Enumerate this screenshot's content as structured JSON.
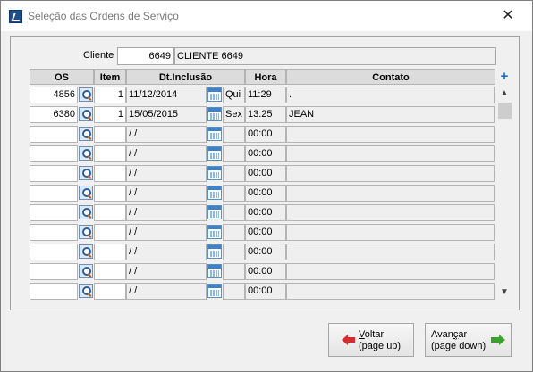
{
  "window": {
    "title": "Seleção das Ordens de Serviço",
    "close_label": "✕"
  },
  "cliente": {
    "label": "Cliente",
    "code": "6649",
    "name": "CLIENTE 6649"
  },
  "table": {
    "columns": {
      "os": "OS",
      "item": "Item",
      "dt": "Dt.Inclusão",
      "hora": "Hora",
      "contato": "Contato"
    },
    "add_label": "+",
    "rows": [
      {
        "os": "4856",
        "item": "1",
        "dt": "11/12/2014",
        "dia": "Qui",
        "hora": "11:29",
        "contato": "."
      },
      {
        "os": "6380",
        "item": "1",
        "dt": "15/05/2015",
        "dia": "Sex",
        "hora": "13:25",
        "contato": "JEAN"
      },
      {
        "os": "",
        "item": "",
        "dt": " / /",
        "dia": "",
        "hora": "00:00",
        "contato": ""
      },
      {
        "os": "",
        "item": "",
        "dt": " / /",
        "dia": "",
        "hora": "00:00",
        "contato": ""
      },
      {
        "os": "",
        "item": "",
        "dt": " / /",
        "dia": "",
        "hora": "00:00",
        "contato": ""
      },
      {
        "os": "",
        "item": "",
        "dt": " / /",
        "dia": "",
        "hora": "00:00",
        "contato": ""
      },
      {
        "os": "",
        "item": "",
        "dt": " / /",
        "dia": "",
        "hora": "00:00",
        "contato": ""
      },
      {
        "os": "",
        "item": "",
        "dt": " / /",
        "dia": "",
        "hora": "00:00",
        "contato": ""
      },
      {
        "os": "",
        "item": "",
        "dt": " / /",
        "dia": "",
        "hora": "00:00",
        "contato": ""
      },
      {
        "os": "",
        "item": "",
        "dt": " / /",
        "dia": "",
        "hora": "00:00",
        "contato": ""
      },
      {
        "os": "",
        "item": "",
        "dt": " / /",
        "dia": "",
        "hora": "00:00",
        "contato": ""
      }
    ]
  },
  "scroll": {
    "up": "^",
    "down": "v"
  },
  "buttons": {
    "back": {
      "hotkey": "V",
      "rest": "oltar",
      "sub": "(page up)"
    },
    "next": {
      "line1": "Avan",
      "hotkey": "ç",
      "rest": "ar",
      "sub": "(page down)"
    }
  },
  "colors": {
    "back_arrow": "#d72c2c",
    "next_arrow": "#3aa12e",
    "plus": "#1a6cc4"
  }
}
